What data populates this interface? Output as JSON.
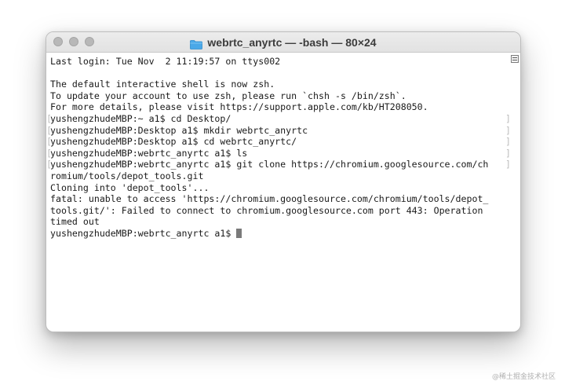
{
  "window": {
    "title": "webrtc_anyrtc — -bash — 80×24",
    "folder_icon_color": "#4aa8e8"
  },
  "terminal": {
    "lines": [
      {
        "text": "Last login: Tue Nov  2 11:19:57 on ttys002",
        "bracket": false
      },
      {
        "text": "",
        "bracket": false
      },
      {
        "text": "The default interactive shell is now zsh.",
        "bracket": false
      },
      {
        "text": "To update your account to use zsh, please run `chsh -s /bin/zsh`.",
        "bracket": false
      },
      {
        "text": "For more details, please visit https://support.apple.com/kb/HT208050.",
        "bracket": false
      },
      {
        "text": "yushengzhudeMBP:~ a1$ cd Desktop/",
        "bracket": true
      },
      {
        "text": "yushengzhudeMBP:Desktop a1$ mkdir webrtc_anyrtc",
        "bracket": true
      },
      {
        "text": "yushengzhudeMBP:Desktop a1$ cd webrtc_anyrtc/",
        "bracket": true
      },
      {
        "text": "yushengzhudeMBP:webrtc_anyrtc a1$ ls",
        "bracket": true
      },
      {
        "text": "yushengzhudeMBP:webrtc_anyrtc a1$ git clone https://chromium.googlesource.com/ch",
        "bracket": true
      },
      {
        "text": "romium/tools/depot_tools.git",
        "bracket": false
      },
      {
        "text": "Cloning into 'depot_tools'...",
        "bracket": false
      },
      {
        "text": "fatal: unable to access 'https://chromium.googlesource.com/chromium/tools/depot_",
        "bracket": false
      },
      {
        "text": "tools.git/': Failed to connect to chromium.googlesource.com port 443: Operation",
        "bracket": false
      },
      {
        "text": "timed out",
        "bracket": false
      },
      {
        "text": "yushengzhudeMBP:webrtc_anyrtc a1$ ",
        "bracket": false,
        "cursor": true
      }
    ]
  },
  "watermark": "@稀土掘金技术社区"
}
